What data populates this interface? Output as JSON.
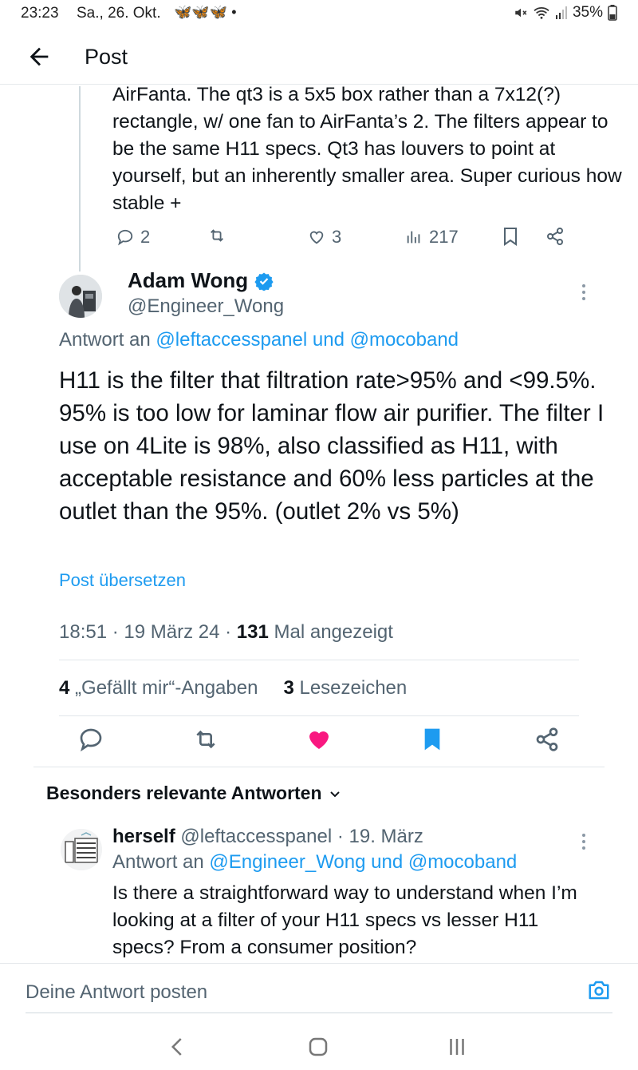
{
  "status": {
    "time": "23:23",
    "date": "Sa., 26. Okt.",
    "notif_icons": "🦋🦋🦋 •",
    "battery": "35%"
  },
  "header": {
    "title": "Post"
  },
  "prev_tweet": {
    "text": "AirFanta. The qt3 is a 5x5 box rather than a 7x12(?) rectangle, w/ one fan to AirFanta’s 2. The filters appear to be the same H11 specs. Qt3 has louvers to point at yourself, but an inherently smaller area. Super curious how stable +",
    "replies": "2",
    "likes": "3",
    "views": "217"
  },
  "main_tweet": {
    "author_name": "Adam Wong",
    "author_handle": "@Engineer_Wong",
    "reply_prefix": "Antwort an",
    "reply_mentions": "@leftaccesspanel und @mocoband",
    "text": "H11 is the filter that filtration rate>95% and <99.5%. 95% is too low for laminar flow air purifier. The filter I use on 4Lite is 98%, also classified as H11, with acceptable resistance and 60% less particles at the outlet than the 95%.  (outlet 2% vs 5%)",
    "translate": "Post übersetzen",
    "timestamp": "18:51 · 19 März 24 ·",
    "view_count": "131",
    "view_label": "Mal angezeigt",
    "likes_count": "4",
    "likes_label": "„Gefällt mir“-Angaben",
    "bookmarks_count": "3",
    "bookmarks_label": "Lesezeichen"
  },
  "relevant_label": "Besonders relevante Antworten",
  "reply": {
    "name": "herself",
    "handle_date": "@leftaccesspanel · 19. März",
    "reply_prefix": "Antwort an",
    "reply_mentions": "@Engineer_Wong und @mocoband",
    "text": "Is there a straightforward way to understand when I’m looking at a filter of your H11 specs vs lesser H11 specs? From a consumer position?"
  },
  "compose": {
    "placeholder": "Deine Antwort posten"
  },
  "colors": {
    "accent": "#1d9bf0",
    "like": "#f91880",
    "muted": "#536471"
  }
}
